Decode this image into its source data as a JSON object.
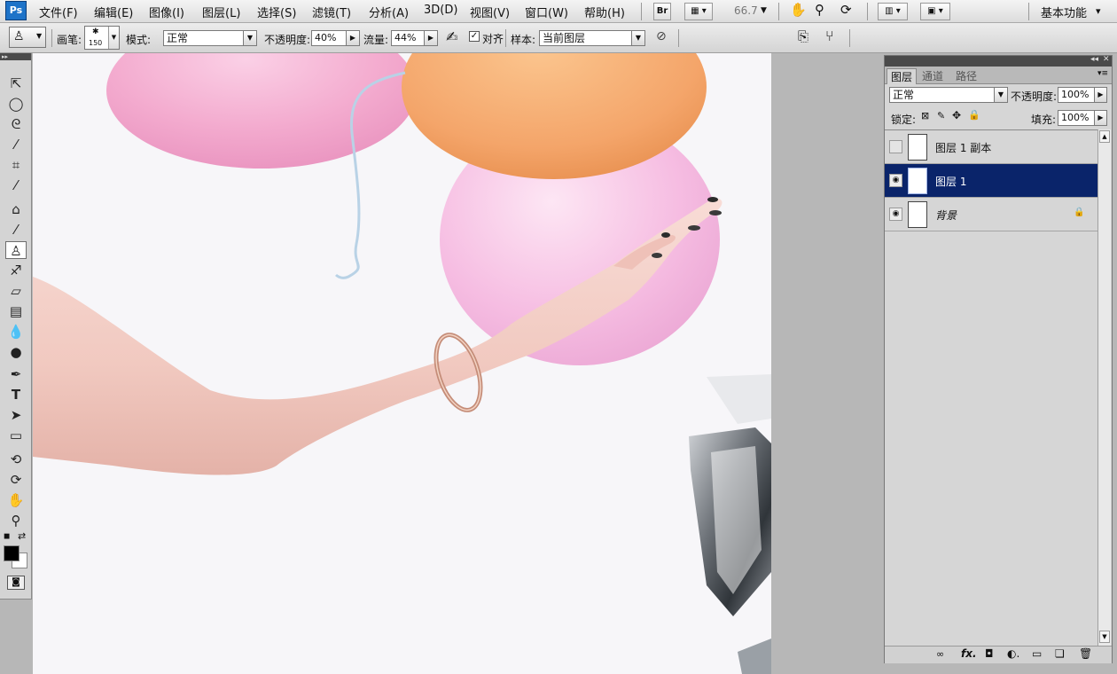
{
  "app": {
    "logo": "Ps"
  },
  "menubar": {
    "items": [
      "文件(F)",
      "编辑(E)",
      "图像(I)",
      "图层(L)",
      "选择(S)",
      "滤镜(T)",
      "分析(A)",
      "3D(D)",
      "视图(V)",
      "窗口(W)",
      "帮助(H)"
    ],
    "bridge_label": "Br",
    "zoom": "66.7",
    "workspace": "基本功能"
  },
  "options": {
    "brush_label": "画笔:",
    "brush_size": "150",
    "mode_label": "模式:",
    "mode_value": "正常",
    "opacity_label": "不透明度:",
    "opacity_value": "40%",
    "flow_label": "流量:",
    "flow_value": "44%",
    "aligned_label": "对齐",
    "aligned_checked": true,
    "sample_label": "样本:",
    "sample_value": "当前图层"
  },
  "tools": [
    "move-tool",
    "marquee-tool",
    "lasso-tool",
    "quick-select-tool",
    "crop-tool",
    "eyedropper-tool",
    "healing-tool",
    "brush-tool",
    "clone-stamp-tool",
    "history-brush-tool",
    "eraser-tool",
    "gradient-tool",
    "blur-tool",
    "dodge-tool",
    "pen-tool",
    "type-tool",
    "path-select-tool",
    "shape-tool",
    "3d-rotate-tool",
    "3d-orbit-tool",
    "hand-tool",
    "zoom-tool"
  ],
  "active_tool": "clone-stamp-tool",
  "colors": {
    "foreground": "#000000",
    "background": "#ffffff",
    "selection": "#0a246a"
  },
  "layers_panel": {
    "tabs": [
      "图层",
      "通道",
      "路径"
    ],
    "blend_mode": "正常",
    "opacity_label": "不透明度:",
    "opacity_value": "100%",
    "lock_label": "锁定:",
    "fill_label": "填充:",
    "fill_value": "100%",
    "layers": [
      {
        "name": "图层 1 副本",
        "visible": false,
        "selected": false,
        "locked": false
      },
      {
        "name": "图层 1",
        "visible": true,
        "selected": true,
        "locked": false
      },
      {
        "name": "背景",
        "visible": true,
        "selected": false,
        "locked": true
      }
    ]
  }
}
